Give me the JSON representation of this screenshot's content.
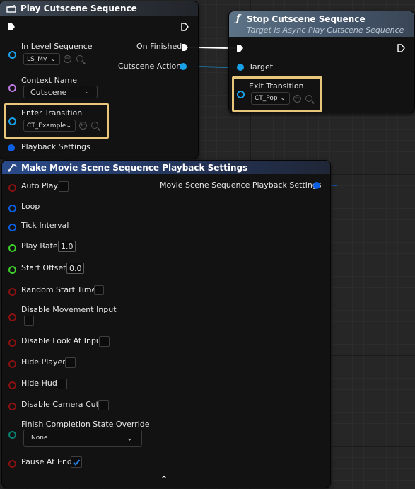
{
  "play_node": {
    "title": "Play Cutscene Sequence",
    "in_level_sequence_label": "In Level Sequence",
    "in_level_sequence_value": "LS_My",
    "on_finished_label": "On Finished",
    "cutscene_action_label": "Cutscene Action",
    "context_name_label": "Context Name",
    "context_name_value": "Cutscene",
    "enter_transition_label": "Enter Transition",
    "enter_transition_value": "CT_Example",
    "playback_settings_label": "Playback Settings"
  },
  "stop_node": {
    "title": "Stop Cutscene Sequence",
    "subtitle": "Target is Async Play Cutscene Sequence",
    "target_label": "Target",
    "exit_transition_label": "Exit Transition",
    "exit_transition_value": "CT_Pop"
  },
  "make_node": {
    "title": "Make Movie Scene Sequence Playback Settings",
    "output_label": "Movie Scene Sequence Playback Settings",
    "auto_play_label": "Auto Play",
    "loop_label": "Loop",
    "tick_interval_label": "Tick Interval",
    "play_rate_label": "Play Rate",
    "play_rate_value": "1.0",
    "start_offset_label": "Start Offset",
    "start_offset_value": "0.0",
    "random_start_time_label": "Random Start Time",
    "disable_movement_input_label": "Disable Movement Input",
    "disable_look_at_input_label": "Disable Look At Input",
    "hide_player_label": "Hide Player",
    "hide_hud_label": "Hide Hud",
    "disable_camera_cuts_label": "Disable Camera Cuts",
    "finish_completion_label": "Finish Completion State Override",
    "finish_completion_value": "None",
    "pause_at_end_label": "Pause At End",
    "pause_at_end_checked": true
  },
  "colors": {
    "object_pin": "#1aa0e6",
    "struct_pin": "#0b5fe0",
    "name_pin": "#c07be6",
    "bool_pin": "#8a1111",
    "float_pin": "#3ed22a",
    "enum_pin": "#0a7f70",
    "highlight": "#e8c77a"
  },
  "icons": {
    "cutscene_header": "clapperboard-icon",
    "function_header": "function-f-icon",
    "make_header": "make-struct-icon"
  }
}
